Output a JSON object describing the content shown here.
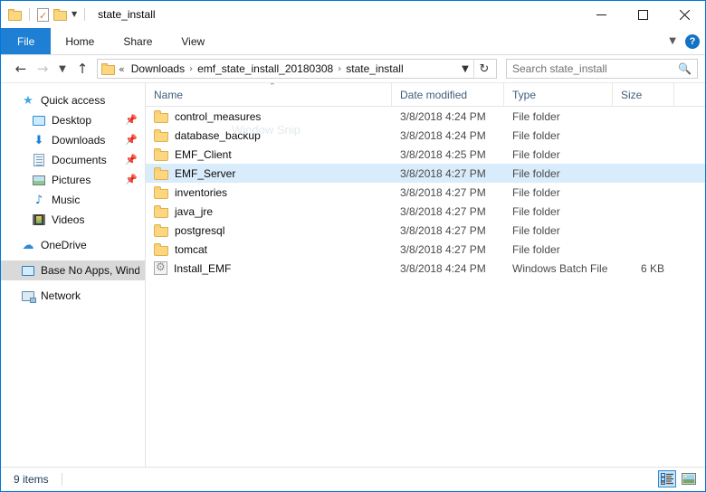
{
  "window": {
    "title": "state_install",
    "quick_access_toolbar": [
      {
        "name": "folder-icon",
        "label": "Folder"
      },
      {
        "name": "properties-icon",
        "label": "Properties"
      },
      {
        "name": "new-folder-icon",
        "label": "New folder"
      },
      {
        "name": "chevron-down-icon",
        "label": "Customize Quick Access Toolbar"
      }
    ],
    "controls": {
      "minimize": "Minimize",
      "maximize": "Maximize",
      "close": "Close"
    }
  },
  "ribbon": {
    "tabs": [
      {
        "label": "File"
      },
      {
        "label": "Home"
      },
      {
        "label": "Share"
      },
      {
        "label": "View"
      }
    ],
    "expand_label": "Expand the Ribbon",
    "help_label": "?"
  },
  "navigation": {
    "back_label": "Back",
    "forward_label": "Forward",
    "recent_label": "Recent locations",
    "up_label": "Up",
    "refresh_label": "Refresh",
    "breadcrumb_overflow": "«",
    "breadcrumb": [
      {
        "label": "Downloads"
      },
      {
        "label": "emf_state_install_20180308"
      },
      {
        "label": "state_install"
      }
    ],
    "separator": "›",
    "dropdown_label": "Previous Locations"
  },
  "search": {
    "placeholder": "Search state_install",
    "value": "",
    "icon": "search-icon"
  },
  "sidebar": {
    "items": [
      {
        "label": "Quick access",
        "icon": "quick-access-star-icon",
        "indent": 0,
        "pinned": false,
        "selected": false
      },
      {
        "label": "Desktop",
        "icon": "desktop-icon",
        "indent": 1,
        "pinned": true,
        "selected": false
      },
      {
        "label": "Downloads",
        "icon": "downloads-arrow-icon",
        "indent": 1,
        "pinned": true,
        "selected": false
      },
      {
        "label": "Documents",
        "icon": "documents-icon",
        "indent": 1,
        "pinned": true,
        "selected": false
      },
      {
        "label": "Pictures",
        "icon": "pictures-icon",
        "indent": 1,
        "pinned": true,
        "selected": false
      },
      {
        "label": "Music",
        "icon": "music-note-icon",
        "indent": 1,
        "pinned": false,
        "selected": false
      },
      {
        "label": "Videos",
        "icon": "videos-icon",
        "indent": 1,
        "pinned": false,
        "selected": false
      },
      {
        "label": "OneDrive",
        "icon": "onedrive-cloud-icon",
        "indent": 0,
        "pinned": false,
        "selected": false
      },
      {
        "label": "Base No Apps, Windo",
        "icon": "this-pc-icon",
        "indent": 0,
        "pinned": false,
        "selected": true
      },
      {
        "label": "Network",
        "icon": "network-icon",
        "indent": 0,
        "pinned": false,
        "selected": false
      }
    ],
    "pin_glyph": "📌"
  },
  "file_list": {
    "columns": [
      {
        "label": "Name",
        "key": "name"
      },
      {
        "label": "Date modified",
        "key": "date"
      },
      {
        "label": "Type",
        "key": "type"
      },
      {
        "label": "Size",
        "key": "size"
      }
    ],
    "sort": {
      "column": "Name",
      "direction": "ascending",
      "glyph": "⌃"
    },
    "watermark": "Window Snip",
    "rows": [
      {
        "name": "control_measures",
        "date": "3/8/2018 4:24 PM",
        "type": "File folder",
        "size": "",
        "icon": "folder-icon",
        "selected": false
      },
      {
        "name": "database_backup",
        "date": "3/8/2018 4:24 PM",
        "type": "File folder",
        "size": "",
        "icon": "folder-icon",
        "selected": false
      },
      {
        "name": "EMF_Client",
        "date": "3/8/2018 4:25 PM",
        "type": "File folder",
        "size": "",
        "icon": "folder-icon",
        "selected": false
      },
      {
        "name": "EMF_Server",
        "date": "3/8/2018 4:27 PM",
        "type": "File folder",
        "size": "",
        "icon": "folder-icon",
        "selected": true
      },
      {
        "name": "inventories",
        "date": "3/8/2018 4:27 PM",
        "type": "File folder",
        "size": "",
        "icon": "folder-icon",
        "selected": false
      },
      {
        "name": "java_jre",
        "date": "3/8/2018 4:27 PM",
        "type": "File folder",
        "size": "",
        "icon": "folder-icon",
        "selected": false
      },
      {
        "name": "postgresql",
        "date": "3/8/2018 4:27 PM",
        "type": "File folder",
        "size": "",
        "icon": "folder-icon",
        "selected": false
      },
      {
        "name": "tomcat",
        "date": "3/8/2018 4:27 PM",
        "type": "File folder",
        "size": "",
        "icon": "folder-icon",
        "selected": false
      },
      {
        "name": "Install_EMF",
        "date": "3/8/2018 4:24 PM",
        "type": "Windows Batch File",
        "size": "6 KB",
        "icon": "batch-file-icon",
        "selected": false
      }
    ]
  },
  "status_bar": {
    "item_count": "9 items",
    "views": [
      {
        "name": "details-view-button",
        "label": "Details view",
        "active": true
      },
      {
        "name": "large-icons-view-button",
        "label": "Large icons view",
        "active": false
      }
    ]
  },
  "colors": {
    "accent": "#1e7fd4",
    "window_border": "#0078d7",
    "selection": "#d9ecfb",
    "nav_selection": "#d9d9d9",
    "folder": "#fcd77f",
    "header_text": "#3f5e7e"
  }
}
